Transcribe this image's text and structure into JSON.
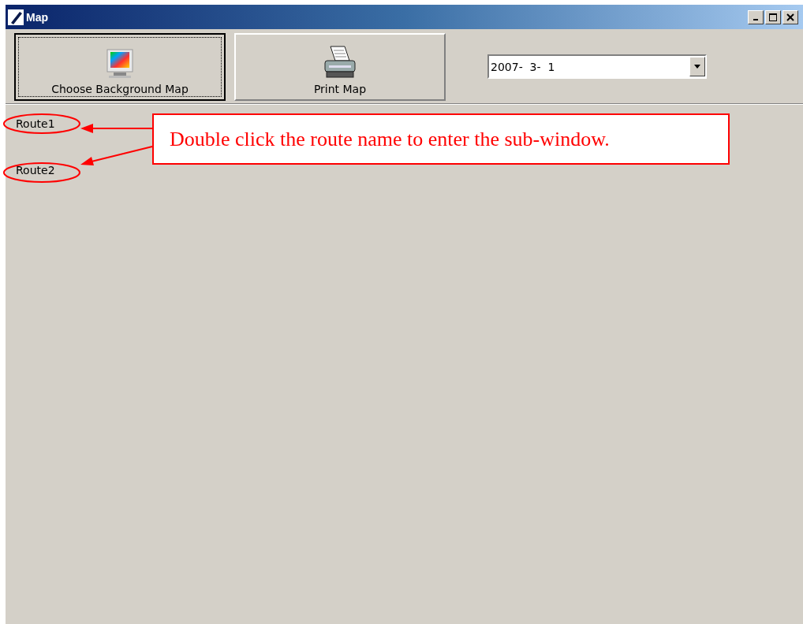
{
  "window": {
    "title": "Map"
  },
  "toolbar": [
    {
      "label": "Choose Background Map",
      "kind": "monitor",
      "focused": true
    },
    {
      "label": "Print Map",
      "kind": "printer",
      "focused": false
    }
  ],
  "date_combo": {
    "value": "2007-  3-  1"
  },
  "routes": [
    "Route1",
    "Route2"
  ],
  "annotation": {
    "text": "Double click the route name to enter the sub-window."
  }
}
